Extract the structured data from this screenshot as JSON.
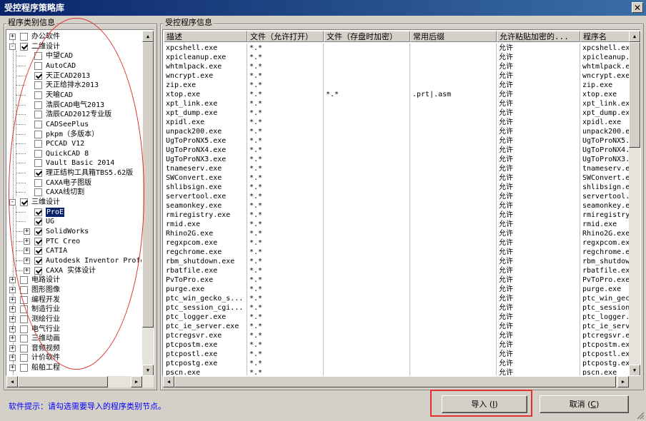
{
  "window": {
    "title": "受控程序策略库",
    "close_glyph": "✕"
  },
  "left_panel": {
    "group_title": "程序类别信息",
    "tree": [
      {
        "label": "办公软件",
        "level": 0,
        "expander": "+",
        "checked": false
      },
      {
        "label": "二维设计",
        "level": 0,
        "expander": "-",
        "checked": true
      },
      {
        "label": "中望CAD",
        "level": 1,
        "expander": "",
        "checked": false
      },
      {
        "label": "AutoCAD",
        "level": 1,
        "expander": "",
        "checked": false
      },
      {
        "label": "天正CAD2013",
        "level": 1,
        "expander": "",
        "checked": true
      },
      {
        "label": "天正给排水2013",
        "level": 1,
        "expander": "",
        "checked": false
      },
      {
        "label": "天喻CAD",
        "level": 1,
        "expander": "",
        "checked": false
      },
      {
        "label": "浩辰CAD电气2013",
        "level": 1,
        "expander": "",
        "checked": false
      },
      {
        "label": "浩辰CAD2012专业版",
        "level": 1,
        "expander": "",
        "checked": false
      },
      {
        "label": "CADSeePlus",
        "level": 1,
        "expander": "",
        "checked": false
      },
      {
        "label": "pkpm（多版本）",
        "level": 1,
        "expander": "",
        "checked": false
      },
      {
        "label": "PCCAD V12",
        "level": 1,
        "expander": "",
        "checked": false
      },
      {
        "label": "QuickCAD 8",
        "level": 1,
        "expander": "",
        "checked": false
      },
      {
        "label": "Vault Basic 2014",
        "level": 1,
        "expander": "",
        "checked": false
      },
      {
        "label": "理正结构工具箱TBS5.62版",
        "level": 1,
        "expander": "",
        "checked": true
      },
      {
        "label": "CAXA电子图版",
        "level": 1,
        "expander": "",
        "checked": false
      },
      {
        "label": "CAXA线切割",
        "level": 1,
        "expander": "",
        "checked": false
      },
      {
        "label": "三维设计",
        "level": 0,
        "expander": "-",
        "checked": true
      },
      {
        "label": "ProE",
        "level": 1,
        "expander": "",
        "checked": true,
        "selected": true
      },
      {
        "label": "UG",
        "level": 1,
        "expander": "",
        "checked": true
      },
      {
        "label": "SolidWorks",
        "level": 1,
        "expander": "+",
        "checked": true
      },
      {
        "label": "PTC Creo",
        "level": 1,
        "expander": "+",
        "checked": true
      },
      {
        "label": "CATIA",
        "level": 1,
        "expander": "+",
        "checked": true
      },
      {
        "label": "Autodesk Inventor Profe",
        "level": 1,
        "expander": "+",
        "checked": true
      },
      {
        "label": "CAXA 实体设计",
        "level": 1,
        "expander": "+",
        "checked": true
      },
      {
        "label": "电路设计",
        "level": 0,
        "expander": "+",
        "checked": false
      },
      {
        "label": "图形图像",
        "level": 0,
        "expander": "+",
        "checked": false
      },
      {
        "label": "编程开发",
        "level": 0,
        "expander": "+",
        "checked": false
      },
      {
        "label": "制造行业",
        "level": 0,
        "expander": "+",
        "checked": false
      },
      {
        "label": "测绘行业",
        "level": 0,
        "expander": "+",
        "checked": false
      },
      {
        "label": "电气行业",
        "level": 0,
        "expander": "+",
        "checked": false
      },
      {
        "label": "三维动画",
        "level": 0,
        "expander": "+",
        "checked": false
      },
      {
        "label": "音频视频",
        "level": 0,
        "expander": "+",
        "checked": false
      },
      {
        "label": "计价软件",
        "level": 0,
        "expander": "+",
        "checked": false
      },
      {
        "label": "船舶工程",
        "level": 0,
        "expander": "+",
        "checked": false
      }
    ]
  },
  "right_panel": {
    "group_title": "受控程序信息",
    "columns": [
      "描述",
      "文件（允许打开）",
      "文件（存盘时加密）",
      "常用后缀",
      "允许粘贴加密的...",
      "程序名"
    ],
    "rows": [
      [
        "xpcshell.exe",
        "*.*",
        "",
        "",
        "允许",
        "xpcshell.exe"
      ],
      [
        "xpicleanup.exe",
        "*.*",
        "",
        "",
        "允许",
        "xpicleanup.exe"
      ],
      [
        "whtmlpack.exe",
        "*.*",
        "",
        "",
        "允许",
        "whtmlpack.exe"
      ],
      [
        "wncrypt.exe",
        "*.*",
        "",
        "",
        "允许",
        "wncrypt.exe"
      ],
      [
        "zip.exe",
        "*.*",
        "",
        "",
        "允许",
        "zip.exe"
      ],
      [
        "xtop.exe",
        "*.*",
        "*.*",
        ".prt|.asm",
        "允许",
        "xtop.exe"
      ],
      [
        "xpt_link.exe",
        "*.*",
        "",
        "",
        "允许",
        "xpt_link.exe"
      ],
      [
        "xpt_dump.exe",
        "*.*",
        "",
        "",
        "允许",
        "xpt_dump.exe"
      ],
      [
        "xpidl.exe",
        "*.*",
        "",
        "",
        "允许",
        "xpidl.exe"
      ],
      [
        "unpack200.exe",
        "*.*",
        "",
        "",
        "允许",
        "unpack200.exe"
      ],
      [
        "UgToProNX5.exe",
        "*.*",
        "",
        "",
        "允许",
        "UgToProNX5.exe"
      ],
      [
        "UgToProNX4.exe",
        "*.*",
        "",
        "",
        "允许",
        "UgToProNX4.exe"
      ],
      [
        "UgToProNX3.exe",
        "*.*",
        "",
        "",
        "允许",
        "UgToProNX3.exe"
      ],
      [
        "tnameserv.exe",
        "*.*",
        "",
        "",
        "允许",
        "tnameserv.exe"
      ],
      [
        "SWConvert.exe",
        "*.*",
        "",
        "",
        "允许",
        "SWConvert.exe"
      ],
      [
        "shlibsign.exe",
        "*.*",
        "",
        "",
        "允许",
        "shlibsign.exe"
      ],
      [
        "servertool.exe",
        "*.*",
        "",
        "",
        "允许",
        "servertool.exe"
      ],
      [
        "seamonkey.exe",
        "*.*",
        "",
        "",
        "允许",
        "seamonkey.exe"
      ],
      [
        "rmiregistry.exe",
        "*.*",
        "",
        "",
        "允许",
        "rmiregistry.exe"
      ],
      [
        "rmid.exe",
        "*.*",
        "",
        "",
        "允许",
        "rmid.exe"
      ],
      [
        "Rhino2G.exe",
        "*.*",
        "",
        "",
        "允许",
        "Rhino2G.exe"
      ],
      [
        "regxpcom.exe",
        "*.*",
        "",
        "",
        "允许",
        "regxpcom.exe"
      ],
      [
        "regchrome.exe",
        "*.*",
        "",
        "",
        "允许",
        "regchrome.exe"
      ],
      [
        "rbm_shutdown.exe",
        "*.*",
        "",
        "",
        "允许",
        "rbm_shutdown.exe"
      ],
      [
        "rbatfile.exe",
        "*.*",
        "",
        "",
        "允许",
        "rbatfile.exe"
      ],
      [
        "PvToPro.exe",
        "*.*",
        "",
        "",
        "允许",
        "PvToPro.exe"
      ],
      [
        "purge.exe",
        "*.*",
        "",
        "",
        "允许",
        "purge.exe"
      ],
      [
        "ptc_win_gecko_s...",
        "*.*",
        "",
        "",
        "允许",
        "ptc_win_gecko_s"
      ],
      [
        "ptc_session_cgi...",
        "*.*",
        "",
        "",
        "允许",
        "ptc_session_cgi"
      ],
      [
        "ptc_logger.exe",
        "*.*",
        "",
        "",
        "允许",
        "ptc_logger.exe"
      ],
      [
        "ptc_ie_server.exe",
        "*.*",
        "",
        "",
        "允许",
        "ptc_ie_server.exe"
      ],
      [
        "ptcregsvr.exe",
        "*.*",
        "",
        "",
        "允许",
        "ptcregsvr.exe"
      ],
      [
        "ptcpostm.exe",
        "*.*",
        "",
        "",
        "允许",
        "ptcpostm.exe"
      ],
      [
        "ptcpostl.exe",
        "*.*",
        "",
        "",
        "允许",
        "ptcpostl.exe"
      ],
      [
        "ptcpostg.exe",
        "*.*",
        "",
        "",
        "允许",
        "ptcpostg.exe"
      ],
      [
        "pscn.exe",
        "*.*",
        "",
        "",
        "允许",
        "pscn.exe"
      ]
    ]
  },
  "footer": {
    "hint": "软件提示：请勾选需要导入的程序类别节点。",
    "import_label": "导入",
    "import_key": "I",
    "cancel_label": "取消",
    "cancel_key": "C"
  },
  "colors": {
    "annotation": "#e03030",
    "selection": "#0a246a",
    "hint_text": "#0000ff"
  }
}
